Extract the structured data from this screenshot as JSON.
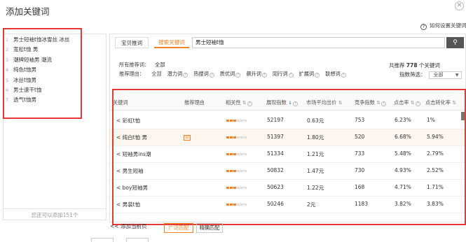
{
  "dialog": {
    "title": "添加关键词",
    "help_text": "如何设置关键词"
  },
  "left": {
    "keywords": [
      {
        "num": "1",
        "text": "男士短袖t恤冰雪丝 冰丝"
      },
      {
        "num": "2",
        "text": "宽松t恤 男"
      },
      {
        "num": "3",
        "text": "潮牌短袖男 潮流"
      },
      {
        "num": "4",
        "text": "纯色t恤男"
      },
      {
        "num": "5",
        "text": "冰丝t恤男"
      },
      {
        "num": "6",
        "text": "男士速干t恤"
      },
      {
        "num": "7",
        "text": "透气t恤男"
      }
    ],
    "footer": "您还可以添加151个"
  },
  "tabs": {
    "a": "宝贝推词",
    "b": "搜索关键词"
  },
  "search": {
    "value": "男士短袖t恤"
  },
  "filters": {
    "source_label": "所有推荐词：",
    "source_all": "全部",
    "reason_label": "推荐理由：",
    "reasons": [
      "全部",
      "潜力词",
      "热搜词",
      "质优词",
      "飙升词",
      "同行词",
      "扩展词",
      "联想词"
    ],
    "recommend_prefix": "共推荐",
    "recommend_count": "778",
    "recommend_suffix": "个关键词",
    "index_filter_label": "指数筛选：",
    "index_filter_value": "全部"
  },
  "table": {
    "headers": [
      "关键词",
      "推荐理由",
      "相关性",
      "展现指数",
      "市场平均出价",
      "竞争指数",
      "点击率",
      "点击转化率"
    ],
    "rows": [
      {
        "keyword": "彩虹t恤",
        "reason": "",
        "relevance_level": 3,
        "impressions": "52197",
        "avg_bid": "0.63元",
        "competition": "753",
        "ctr": "6.23%",
        "cvr": "1%"
      },
      {
        "keyword": "纯白t恤 男",
        "reason": "回",
        "relevance_level": 3,
        "impressions": "51397",
        "avg_bid": "1.80元",
        "competition": "520",
        "ctr": "6.68%",
        "cvr": "5.94%"
      },
      {
        "keyword": "短袖男ins潮",
        "reason": "",
        "relevance_level": 3,
        "impressions": "51334",
        "avg_bid": "1.21元",
        "competition": "733",
        "ctr": "5.48%",
        "cvr": "2.79%"
      },
      {
        "keyword": "男生短袖",
        "reason": "",
        "relevance_level": 3,
        "impressions": "50832",
        "avg_bid": "1.47元",
        "competition": "730",
        "ctr": "4.93%",
        "cvr": "2.52%"
      },
      {
        "keyword": "boy短袖男",
        "reason": "",
        "relevance_level": 3,
        "impressions": "50623",
        "avg_bid": "1.22元",
        "competition": "168",
        "ctr": "4.71%",
        "cvr": "1.71%"
      },
      {
        "keyword": "男装t恤",
        "reason": "",
        "relevance_level": 3,
        "impressions": "50246",
        "avg_bid": "2元",
        "competition": "1183",
        "ctr": "3.82%",
        "cvr": "3.83%"
      }
    ]
  },
  "bottom": {
    "add_page": "添加当前页",
    "broad": "广泛匹配",
    "exact": "精确匹配"
  },
  "colors": {
    "accent": "#f58220",
    "annotation": "#e53935"
  }
}
